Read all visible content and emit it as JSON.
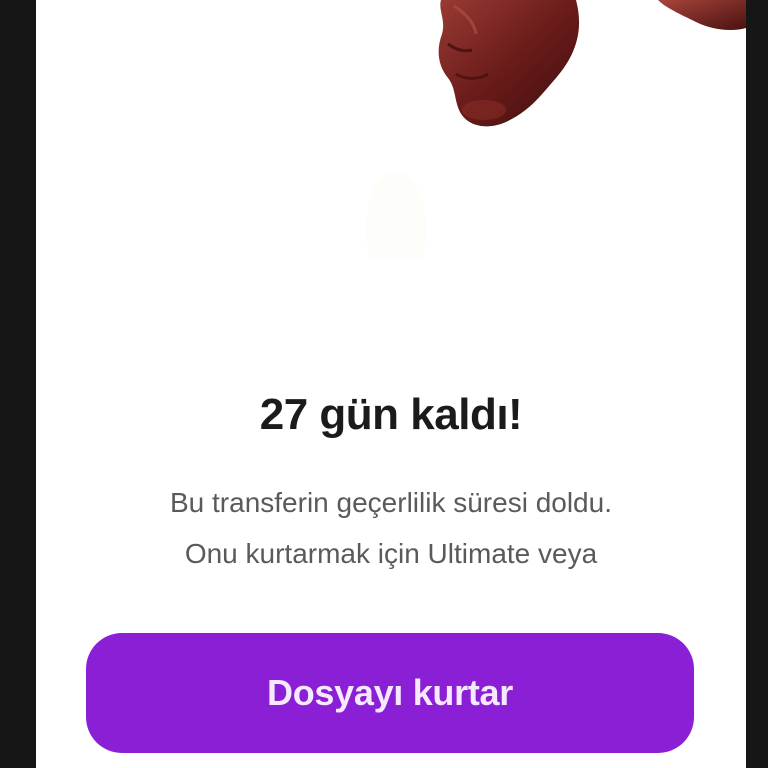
{
  "dialog": {
    "title": "27 gün kaldı!",
    "description_line1": "Bu transferin geçerlilik süresi doldu.",
    "description_line2": "Onu kurtarmak için Ultimate veya",
    "cta_label": "Dosyayı kurtar"
  },
  "colors": {
    "page_background": "#161616",
    "panel_background": "#ffffff",
    "title": "#1b1b1b",
    "description": "#5a5a5a",
    "cta_background": "#8a1fd6",
    "cta_text": "#f4e9ff",
    "sculpture": "#6a1c1a"
  },
  "illustration": {
    "icon": "chocolate-face-sculpture"
  }
}
